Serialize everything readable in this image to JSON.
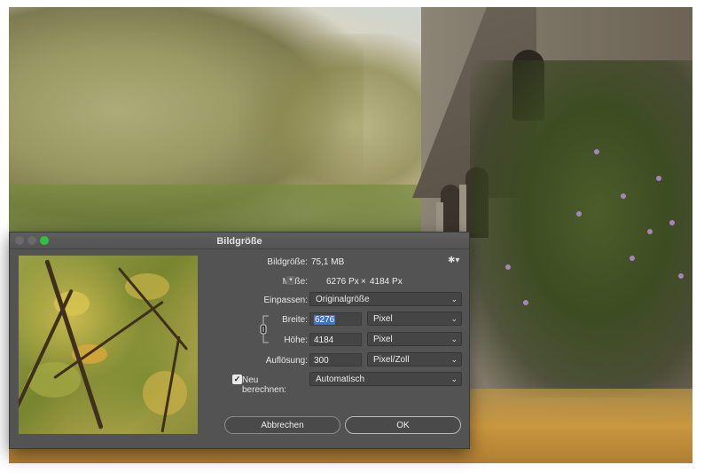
{
  "dialog": {
    "title": "Bildgröße",
    "image_size_label": "Bildgröße:",
    "image_size_value": "75,1 MB",
    "dimensions_label": "Maße:",
    "dimensions_width": "6276 Px",
    "dimensions_sep": "×",
    "dimensions_height": "4184 Px",
    "fit_label": "Einpassen:",
    "fit_value": "Originalgröße",
    "width_label": "Breite:",
    "width_value": "6276",
    "width_unit": "Pixel",
    "height_label": "Höhe:",
    "height_value": "4184",
    "height_unit": "Pixel",
    "resolution_label": "Auflösung:",
    "resolution_value": "300",
    "resolution_unit": "Pixel/Zoll",
    "resample_label": "Neu berechnen:",
    "resample_checked": true,
    "resample_value": "Automatisch",
    "cancel_label": "Abbrechen",
    "ok_label": "OK"
  },
  "colors": {
    "dialog_bg": "#535353",
    "selection": "#3a74c9",
    "close": "#5e5e5e",
    "zoom": "#2fc13f"
  },
  "icons": {
    "gear": "gear-icon",
    "chain": "chain-link-icon",
    "checkbox": "checkmark-icon",
    "dropdown": "chevron-down-icon"
  }
}
